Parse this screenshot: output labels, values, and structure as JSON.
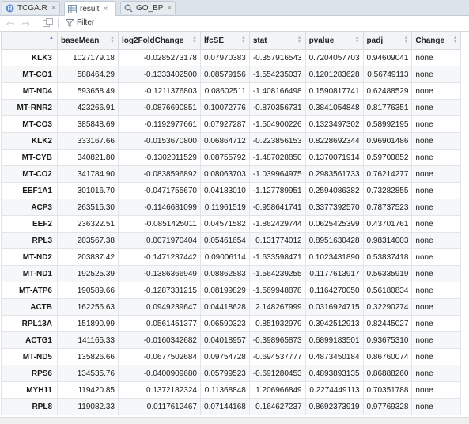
{
  "tabs": [
    {
      "label": "TCGA.R",
      "icon": "r-script-icon"
    },
    {
      "label": "result",
      "icon": "table-icon",
      "active": true
    },
    {
      "label": "GO_BP",
      "icon": "search-icon"
    }
  ],
  "toolbar": {
    "filter_label": "Filter"
  },
  "table": {
    "columns": [
      "",
      "baseMean",
      "log2FoldChange",
      "lfcSE",
      "stat",
      "pvalue",
      "padj",
      "Change"
    ],
    "sorted_column": "",
    "rows": [
      [
        "KLK3",
        "1027179.18",
        "-0.0285273178",
        "0.07970383",
        "-0.357916543",
        "0.7204057703",
        "0.94609041",
        "none"
      ],
      [
        "MT-CO1",
        "588464.29",
        "-0.1333402500",
        "0.08579156",
        "-1.554235037",
        "0.1201283628",
        "0.56749113",
        "none"
      ],
      [
        "MT-ND4",
        "593658.49",
        "-0.1211376803",
        "0.08602511",
        "-1.408166498",
        "0.1590817741",
        "0.62488529",
        "none"
      ],
      [
        "MT-RNR2",
        "423266.91",
        "-0.0876690851",
        "0.10072776",
        "-0.870356731",
        "0.3841054848",
        "0.81776351",
        "none"
      ],
      [
        "MT-CO3",
        "385848.69",
        "-0.1192977661",
        "0.07927287",
        "-1.504900226",
        "0.1323497302",
        "0.58992195",
        "none"
      ],
      [
        "KLK2",
        "333167.66",
        "-0.0153670800",
        "0.06864712",
        "-0.223856153",
        "0.8228692344",
        "0.96901486",
        "none"
      ],
      [
        "MT-CYB",
        "340821.80",
        "-0.1302011529",
        "0.08755792",
        "-1.487028850",
        "0.1370071914",
        "0.59700852",
        "none"
      ],
      [
        "MT-CO2",
        "341784.90",
        "-0.0838596892",
        "0.08063703",
        "-1.039964975",
        "0.2983561733",
        "0.76214277",
        "none"
      ],
      [
        "EEF1A1",
        "301016.70",
        "-0.0471755670",
        "0.04183010",
        "-1.127789951",
        "0.2594086382",
        "0.73282855",
        "none"
      ],
      [
        "ACP3",
        "263515.30",
        "-0.1146681099",
        "0.11961519",
        "-0.958641741",
        "0.3377392570",
        "0.78737523",
        "none"
      ],
      [
        "EEF2",
        "236322.51",
        "-0.0851425011",
        "0.04571582",
        "-1.862429744",
        "0.0625425399",
        "0.43701761",
        "none"
      ],
      [
        "RPL3",
        "203567.38",
        "0.0071970404",
        "0.05461654",
        "0.131774012",
        "0.8951630428",
        "0.98314003",
        "none"
      ],
      [
        "MT-ND2",
        "203837.42",
        "-0.1471237442",
        "0.09006114",
        "-1.633598471",
        "0.1023431890",
        "0.53837418",
        "none"
      ],
      [
        "MT-ND1",
        "192525.39",
        "-0.1386366949",
        "0.08862883",
        "-1.564239255",
        "0.1177613917",
        "0.56335919",
        "none"
      ],
      [
        "MT-ATP6",
        "190589.66",
        "-0.1287331215",
        "0.08199829",
        "-1.569948878",
        "0.1164270050",
        "0.56180834",
        "none"
      ],
      [
        "ACTB",
        "162256.63",
        "0.0949239647",
        "0.04418628",
        "2.148267999",
        "0.0316924715",
        "0.32290274",
        "none"
      ],
      [
        "RPL13A",
        "151890.99",
        "0.0561451377",
        "0.06590323",
        "0.851932979",
        "0.3942512913",
        "0.82445027",
        "none"
      ],
      [
        "ACTG1",
        "141165.33",
        "-0.0160342682",
        "0.04018957",
        "-0.398965873",
        "0.6899183501",
        "0.93675310",
        "none"
      ],
      [
        "MT-ND5",
        "135826.66",
        "-0.0677502684",
        "0.09754728",
        "-0.694537777",
        "0.4873450184",
        "0.86760074",
        "none"
      ],
      [
        "RPS6",
        "134535.76",
        "-0.0400909680",
        "0.05799523",
        "-0.691280453",
        "0.4893893135",
        "0.86888260",
        "none"
      ],
      [
        "MYH11",
        "119420.85",
        "0.1372182324",
        "0.11368848",
        "1.206966849",
        "0.2274449113",
        "0.70351788",
        "none"
      ],
      [
        "RPL8",
        "119082.33",
        "0.0117612467",
        "0.07144168",
        "0.164627237",
        "0.8692373919",
        "0.97769328",
        "none"
      ]
    ]
  }
}
